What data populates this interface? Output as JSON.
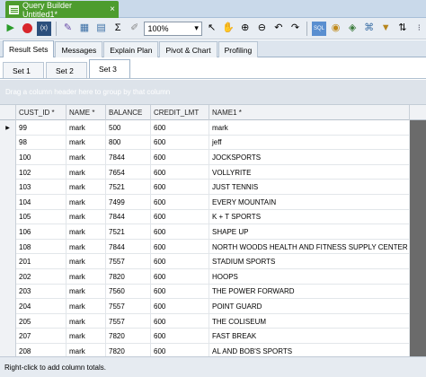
{
  "document_tab": {
    "title": "Query Builder Untitled1*",
    "close": "×"
  },
  "toolbar": {
    "icons": [
      "play-icon",
      "stop-icon",
      "function-icon",
      "wand-icon",
      "table-icon",
      "grid-icon",
      "sigma-icon",
      "edit-icon"
    ],
    "zoom": "100%",
    "sigma": "Σ",
    "fx": "(x)"
  },
  "result_tabs": [
    {
      "label": "Result Sets",
      "active": true
    },
    {
      "label": "Messages",
      "active": false
    },
    {
      "label": "Explain Plan",
      "active": false
    },
    {
      "label": "Pivot & Chart",
      "active": false
    },
    {
      "label": "Profiling",
      "active": false
    }
  ],
  "set_tabs": [
    {
      "label": "Set 1",
      "active": false
    },
    {
      "label": "Set 2",
      "active": false
    },
    {
      "label": "Set 3",
      "active": true
    }
  ],
  "group_panel": {
    "hint": "Drag a column header here to group by that column"
  },
  "grid": {
    "columns": [
      "CUST_ID *",
      "NAME *",
      "BALANCE",
      "CREDIT_LMT",
      "NAME1 *"
    ],
    "rows": [
      [
        "99",
        "mark",
        "500",
        "600",
        "mark"
      ],
      [
        "98",
        "mark",
        "800",
        "600",
        "jeff"
      ],
      [
        "100",
        "mark",
        "7844",
        "600",
        "JOCKSPORTS"
      ],
      [
        "102",
        "mark",
        "7654",
        "600",
        "VOLLYRITE"
      ],
      [
        "103",
        "mark",
        "7521",
        "600",
        "JUST TENNIS"
      ],
      [
        "104",
        "mark",
        "7499",
        "600",
        "EVERY MOUNTAIN"
      ],
      [
        "105",
        "mark",
        "7844",
        "600",
        "K + T SPORTS"
      ],
      [
        "106",
        "mark",
        "7521",
        "600",
        "SHAPE UP"
      ],
      [
        "108",
        "mark",
        "7844",
        "600",
        "NORTH WOODS HEALTH AND FITNESS SUPPLY CENTER"
      ],
      [
        "201",
        "mark",
        "7557",
        "600",
        "STADIUM SPORTS"
      ],
      [
        "202",
        "mark",
        "7820",
        "600",
        "HOOPS"
      ],
      [
        "203",
        "mark",
        "7560",
        "600",
        "THE POWER FORWARD"
      ],
      [
        "204",
        "mark",
        "7557",
        "600",
        "POINT GUARD"
      ],
      [
        "205",
        "mark",
        "7557",
        "600",
        "THE COLISEUM"
      ],
      [
        "207",
        "mark",
        "7820",
        "600",
        "FAST BREAK"
      ],
      [
        "208",
        "mark",
        "7820",
        "600",
        "AL AND BOB'S SPORTS"
      ]
    ],
    "current_row_marker": "▶"
  },
  "status": {
    "text": "Right-click to add column totals."
  }
}
